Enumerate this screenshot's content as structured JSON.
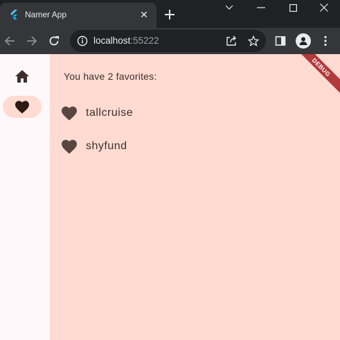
{
  "browser": {
    "tab": {
      "title": "Namer App",
      "close_glyph": "✕"
    },
    "new_tab_icon": "plus-icon",
    "window_controls": [
      "chevron-down-icon",
      "minimize-icon",
      "maximize-icon",
      "close-icon"
    ],
    "address": {
      "host": "localhost",
      "port": ":55222"
    }
  },
  "app": {
    "rail": {
      "destinations": [
        {
          "name": "home",
          "icon": "home-icon",
          "selected": false
        },
        {
          "name": "favorites",
          "icon": "heart-icon",
          "selected": true
        }
      ]
    },
    "favorites": {
      "summary": "You have 2 favorites:",
      "items": [
        "tallcruise",
        "shyfund"
      ]
    },
    "debug_banner": "DEBUG"
  },
  "colors": {
    "accent": "#ffdbd2",
    "text": "#3b302c",
    "rail_bg": "#fff8fa",
    "chrome_dark": "#202124",
    "chrome_toolbar": "#35363a"
  }
}
